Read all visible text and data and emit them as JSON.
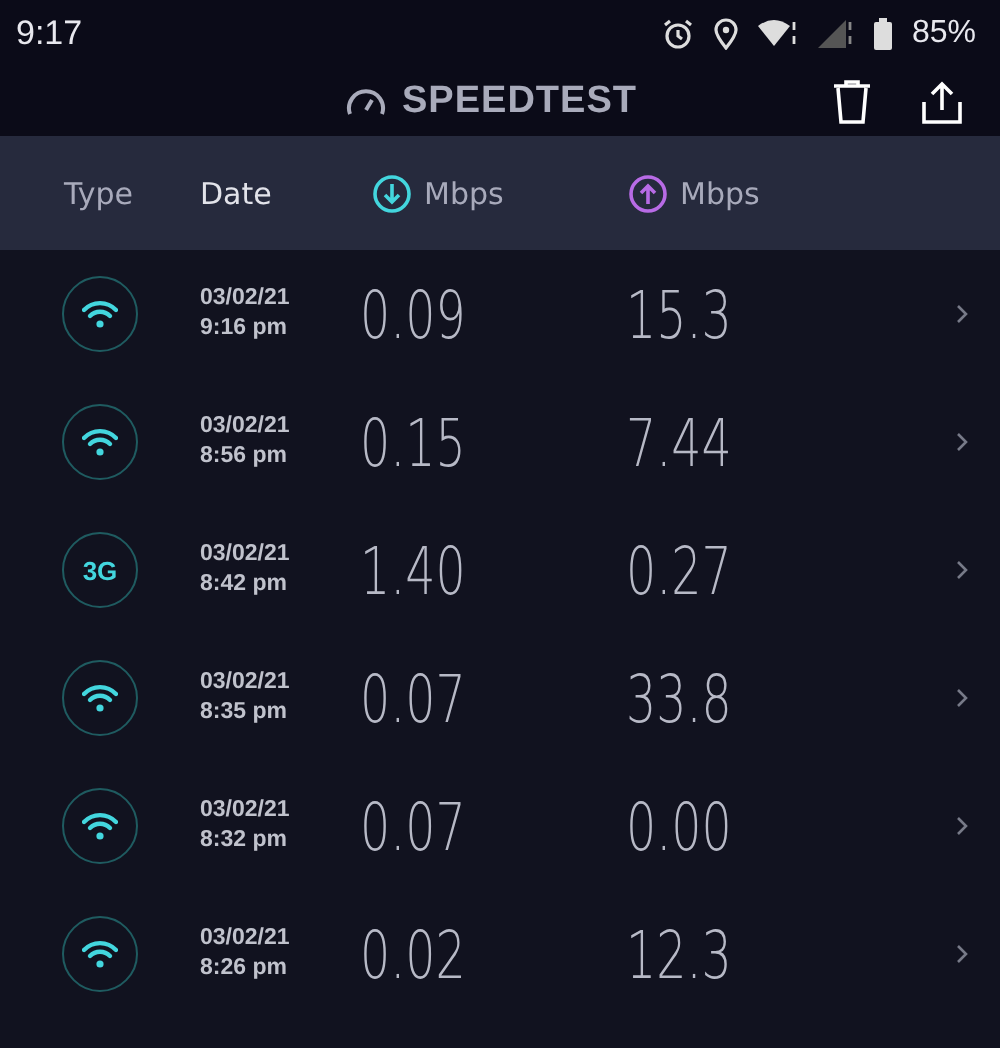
{
  "status_bar": {
    "time": "9:17",
    "battery": "85%"
  },
  "app_bar": {
    "title": "SPEEDTEST"
  },
  "columns": {
    "type": "Type",
    "date": "Date",
    "download": "Mbps",
    "upload": "Mbps"
  },
  "results": [
    {
      "kind": "wifi",
      "date": "03/02/21",
      "time": "9:16 pm",
      "download": "0.09",
      "upload": "15.3"
    },
    {
      "kind": "wifi",
      "date": "03/02/21",
      "time": "8:56 pm",
      "download": "0.15",
      "upload": "7.44"
    },
    {
      "kind": "cellular",
      "network_label": "3G",
      "date": "03/02/21",
      "time": "8:42 pm",
      "download": "1.40",
      "upload": "0.27"
    },
    {
      "kind": "wifi",
      "date": "03/02/21",
      "time": "8:35 pm",
      "download": "0.07",
      "upload": "33.8"
    },
    {
      "kind": "wifi",
      "date": "03/02/21",
      "time": "8:32 pm",
      "download": "0.07",
      "upload": "0.00"
    },
    {
      "kind": "wifi",
      "date": "03/02/21",
      "time": "8:26 pm",
      "download": "0.02",
      "upload": "12.3"
    }
  ]
}
